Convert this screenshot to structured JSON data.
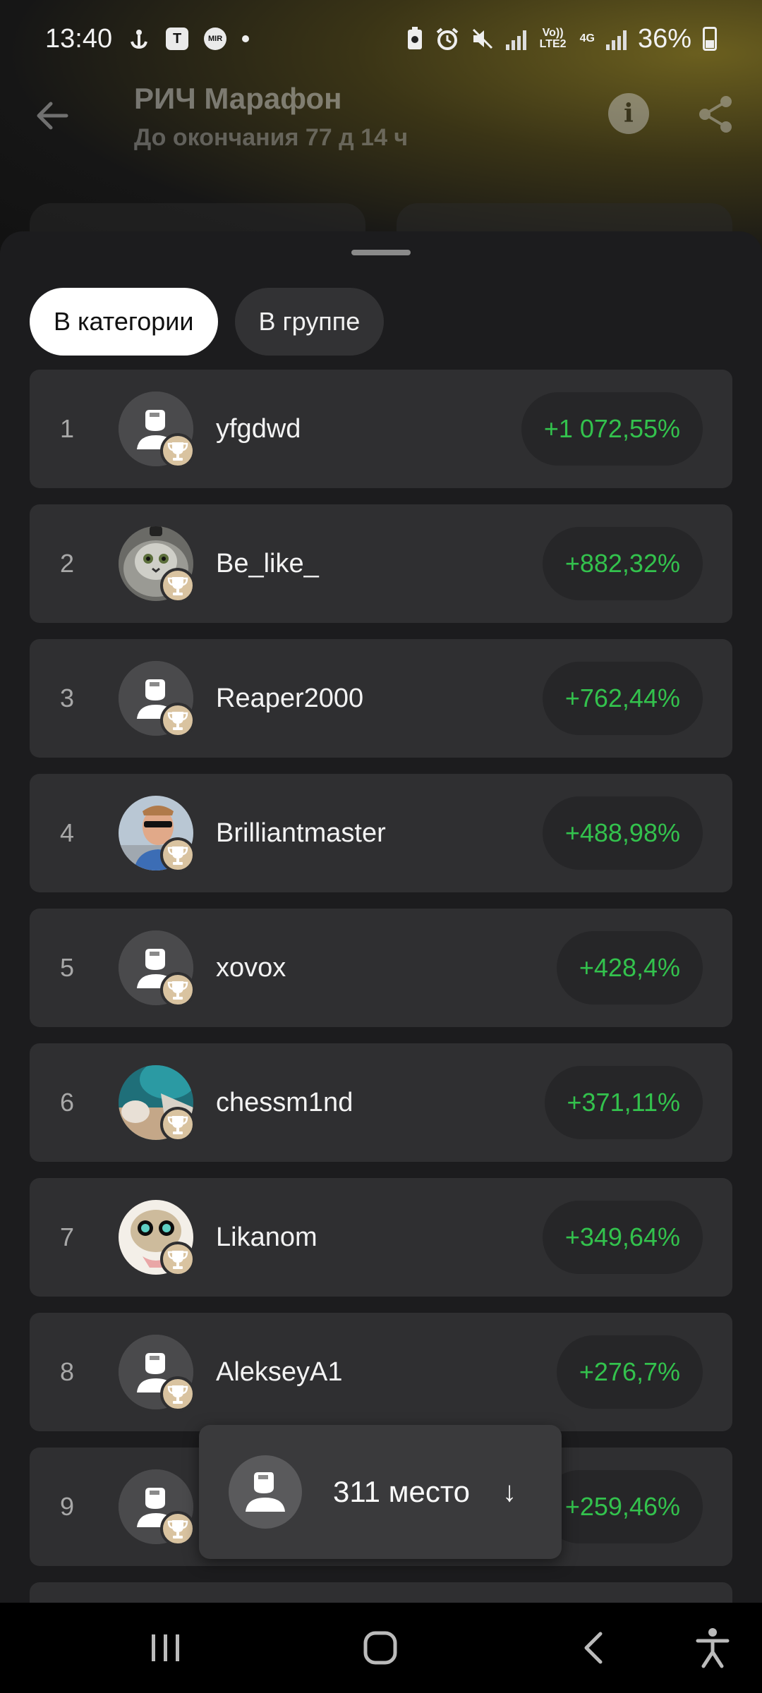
{
  "status_bar": {
    "time": "13:40",
    "battery": "36%",
    "left_icons": [
      "anchor-icon",
      "t-icon",
      "mir-icon",
      "dot-icon"
    ],
    "right_icons": [
      "battery-saver-icon",
      "alarm-icon",
      "mute-icon",
      "signal-icon",
      "lte-icon",
      "4g-icon",
      "signal-icon"
    ],
    "volte": "Vo)) LTE2",
    "network": "4G"
  },
  "header": {
    "title": "РИЧ Марафон",
    "subtitle": "До окончания 77 д 14 ч"
  },
  "tabs": [
    {
      "label": "В категории",
      "active": true
    },
    {
      "label": "В группе",
      "active": false
    }
  ],
  "leaderboard": [
    {
      "rank": "1",
      "name": "yfgdwd",
      "return": "+1 072,55%",
      "avatar": "default"
    },
    {
      "rank": "2",
      "name": "Be_like_",
      "return": "+882,32%",
      "avatar": "cat"
    },
    {
      "rank": "3",
      "name": "Reaper2000",
      "return": "+762,44%",
      "avatar": "default"
    },
    {
      "rank": "4",
      "name": "Brilliantmaster",
      "return": "+488,98%",
      "avatar": "man"
    },
    {
      "rank": "5",
      "name": "xovox",
      "return": "+428,4%",
      "avatar": "default"
    },
    {
      "rank": "6",
      "name": "chessm1nd",
      "return": "+371,11%",
      "avatar": "teal"
    },
    {
      "rank": "7",
      "name": "Likanom",
      "return": "+349,64%",
      "avatar": "cartoon"
    },
    {
      "rank": "8",
      "name": "AlekseyA1",
      "return": "+276,7%",
      "avatar": "default"
    },
    {
      "rank": "9",
      "name": "",
      "return": "+259,46%",
      "avatar": "default"
    }
  ],
  "my_position": {
    "text": "311 место",
    "arrow": "↓"
  },
  "colors": {
    "positive": "#33c24d",
    "card": "#2f2f31",
    "sheet": "#1c1c1e",
    "trophy_badge": "#d9c3a0"
  }
}
